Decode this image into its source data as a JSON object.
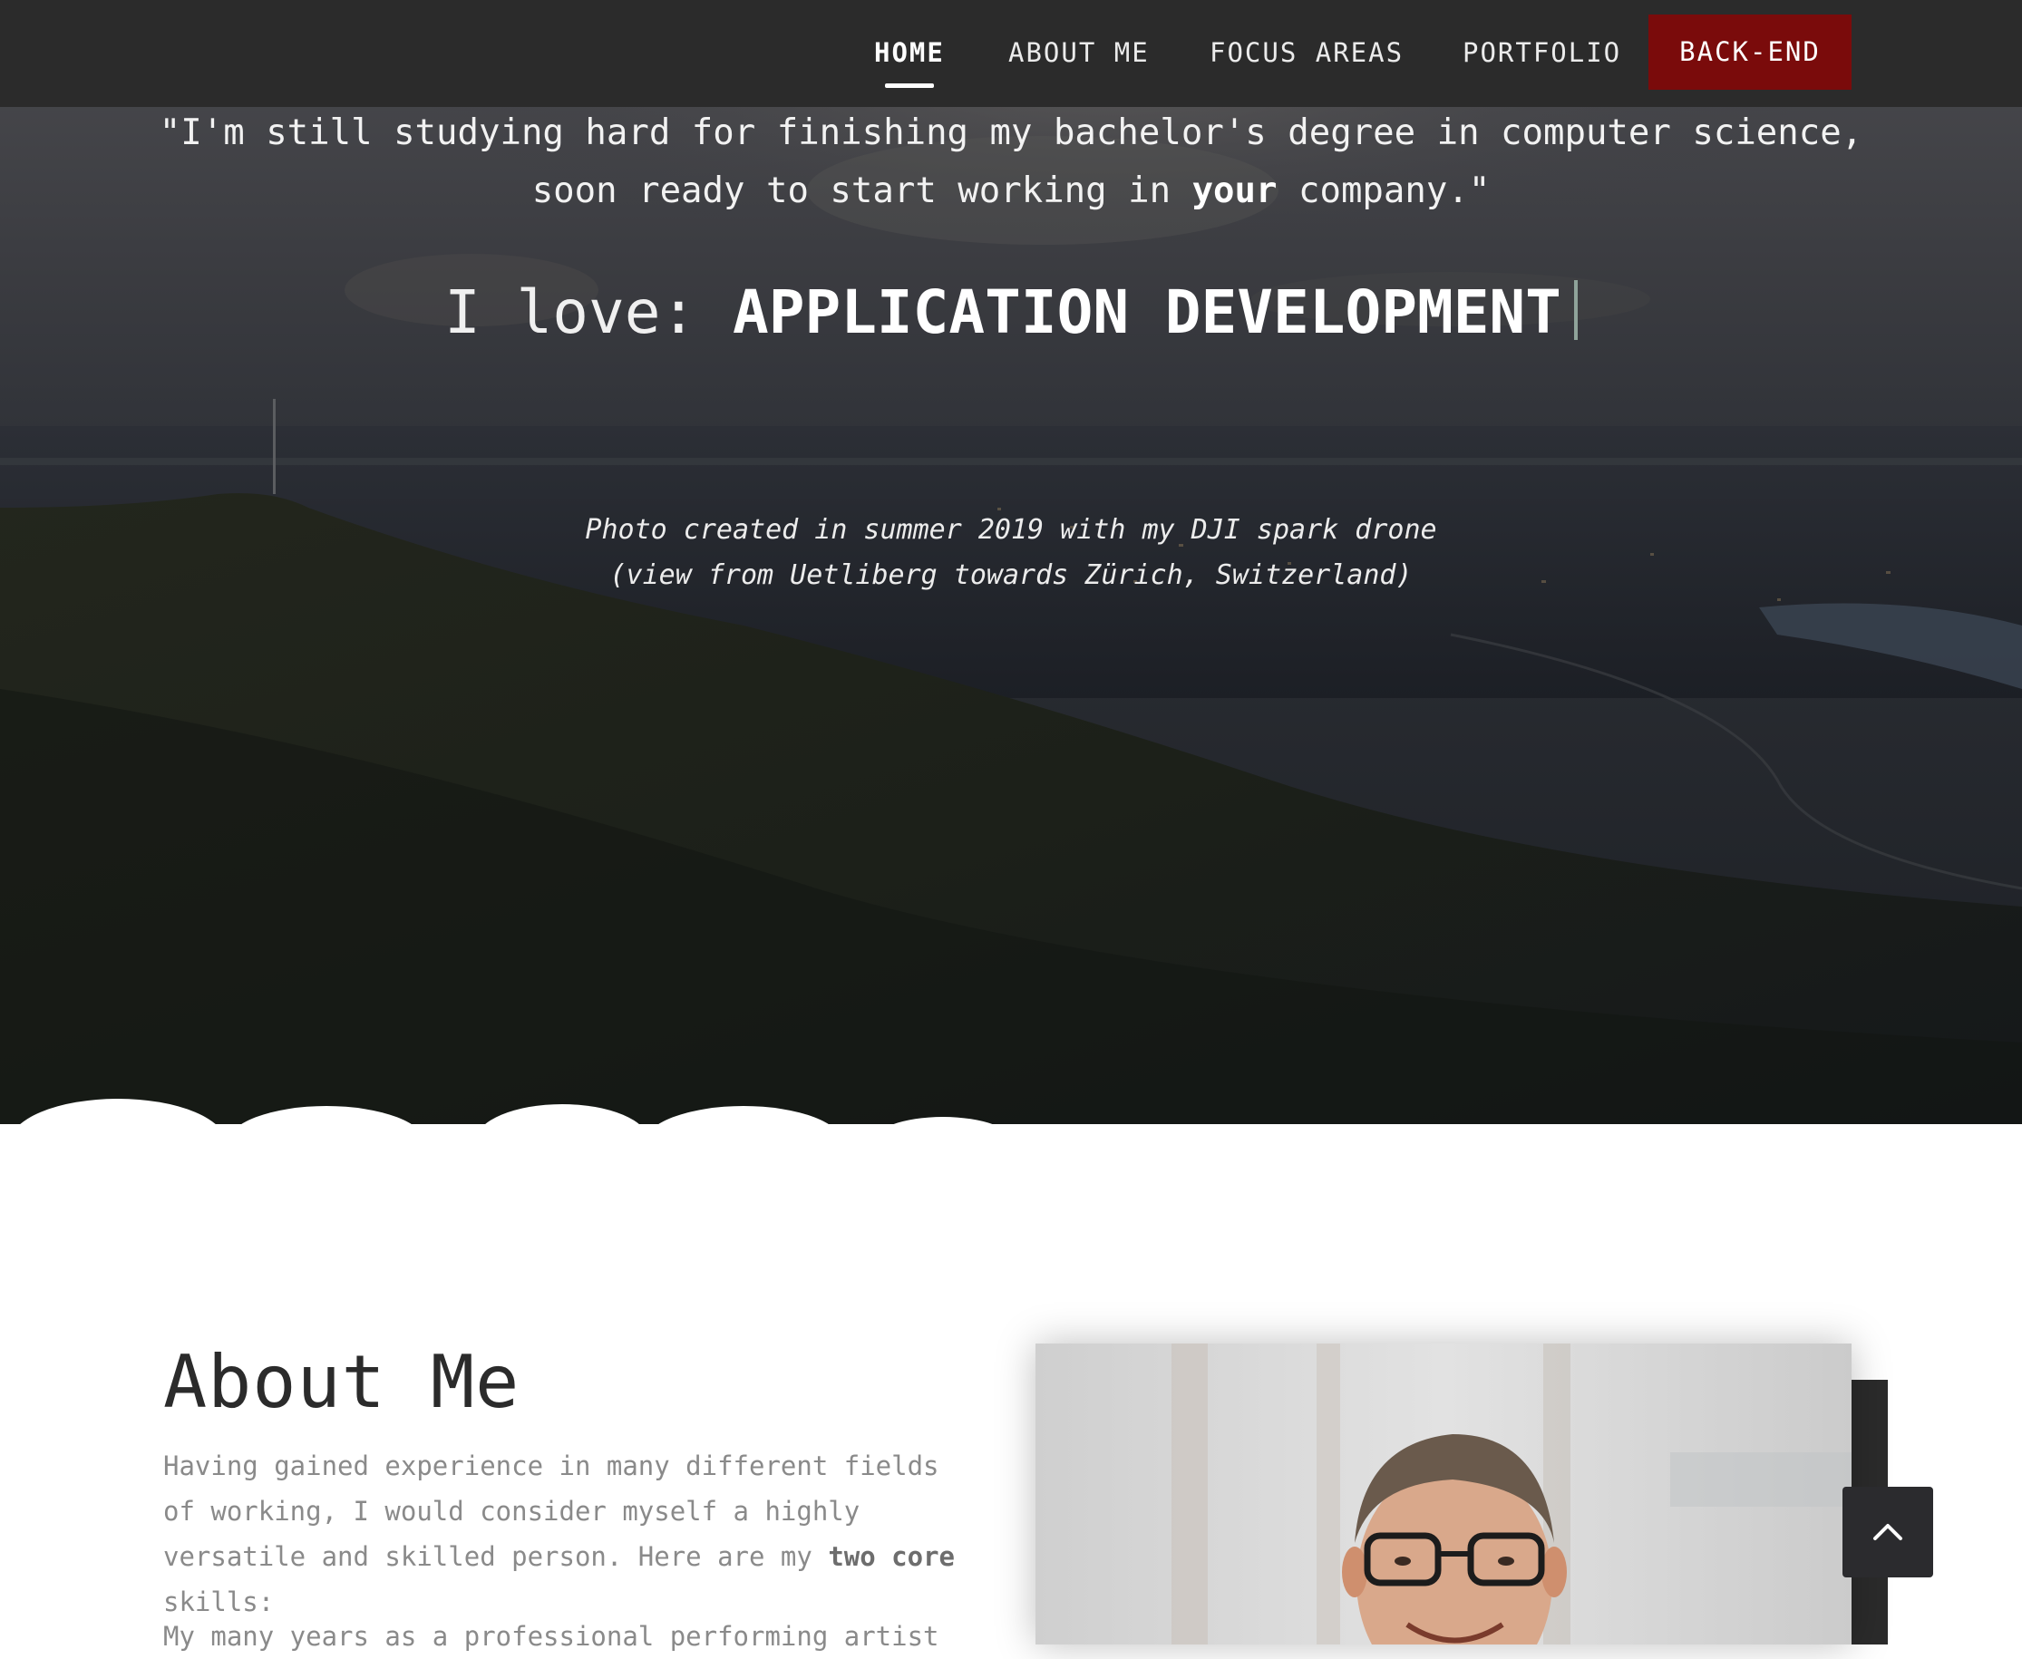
{
  "nav": {
    "items": [
      {
        "label": "HOME",
        "active": true
      },
      {
        "label": "ABOUT ME",
        "active": false
      },
      {
        "label": "FOCUS AREAS",
        "active": false
      },
      {
        "label": "PORTFOLIO",
        "active": false
      }
    ],
    "cta_label": "BACK-END",
    "cta_color": "#7a0b0b",
    "bar_color": "#2b2b2b"
  },
  "hero": {
    "quote_line1": "\"I'm still studying hard for finishing my bachelor's degree in computer science,",
    "quote_line2_pre": "soon ready to start working in ",
    "quote_line2_bold": "your",
    "quote_line2_post": " company.\"",
    "love_prefix": "I love:",
    "love_typed": "APPLICATION DEVELOPMENT",
    "caption_line1": "Photo created in summer 2019 with my DJI spark drone",
    "caption_line2": "(view from Uetliberg towards Zürich, Switzerland)"
  },
  "about": {
    "title": "About Me",
    "para1_pre": "Having gained experience in many different fields of working, I would consider myself a highly versatile and skilled person. Here are my ",
    "para1_bold": "two core",
    "para1_post": " skills:",
    "para2": "My many years as a professional performing artist"
  },
  "icons": {
    "scroll_top": "chevron-up-icon"
  }
}
